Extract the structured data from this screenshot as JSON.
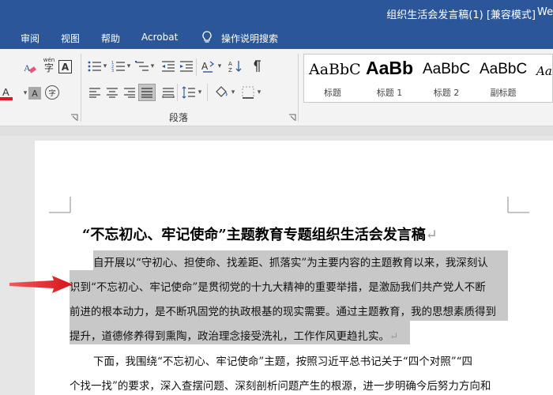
{
  "window": {
    "title": "组织生活会发言稿(1) [兼容模式]",
    "title_cut": "We"
  },
  "tabs": [
    {
      "label": "审阅"
    },
    {
      "label": "视图"
    },
    {
      "label": "帮助"
    },
    {
      "label": "Acrobat"
    },
    {
      "label": "操作说明搜索"
    }
  ],
  "ribbon": {
    "font_group": {
      "wen_label": "wén",
      "wen_char": "字",
      "border_char": "A",
      "shade_char": "A",
      "enclose_char": "字"
    },
    "paragraph_group": {
      "label": "段落"
    }
  },
  "styles": [
    {
      "preview": "AaBbC",
      "name": "标题"
    },
    {
      "preview": "AaBb",
      "name": "标题 1"
    },
    {
      "preview": "AaBbC",
      "name": "标题 2"
    },
    {
      "preview": "AaBbC",
      "name": "副标题"
    },
    {
      "preview": "AaBb",
      "name": ""
    }
  ],
  "document": {
    "title": "“不忘初心、牢记使命”主题教育专题组织生活会发言稿",
    "pilcrow": "↵",
    "paragraph1": [
      "自开展以“守初心、担使命、找差距、抓落实”为主要内容的主题教育以来，我深刻认",
      "识到“不忘初心、牢记使命”是贯彻党的十九大精神的重要举措，是激励我们共产党人不断",
      "前进的根本动力，是不断巩固党的执政根基的现实需要。通过主题教育，我的思想素质得到",
      "提升，道德修养得到熏陶，政治理念接受洗礼，工作作风更趋扎实。"
    ],
    "paragraph2": [
      "下面，我围绕“不忘初心、牢记使命”主题，按照习近平总书记关于“四个对照”“四",
      "个找一找”的要求，深入查摆问题、深刻剖析问题产生的根源，进一步明确今后努力方向和"
    ]
  },
  "colors": {
    "accent": "#2b579a",
    "highlight": "#c8c8c8",
    "arrow": "#e8141a",
    "font_red": "#e81123"
  }
}
